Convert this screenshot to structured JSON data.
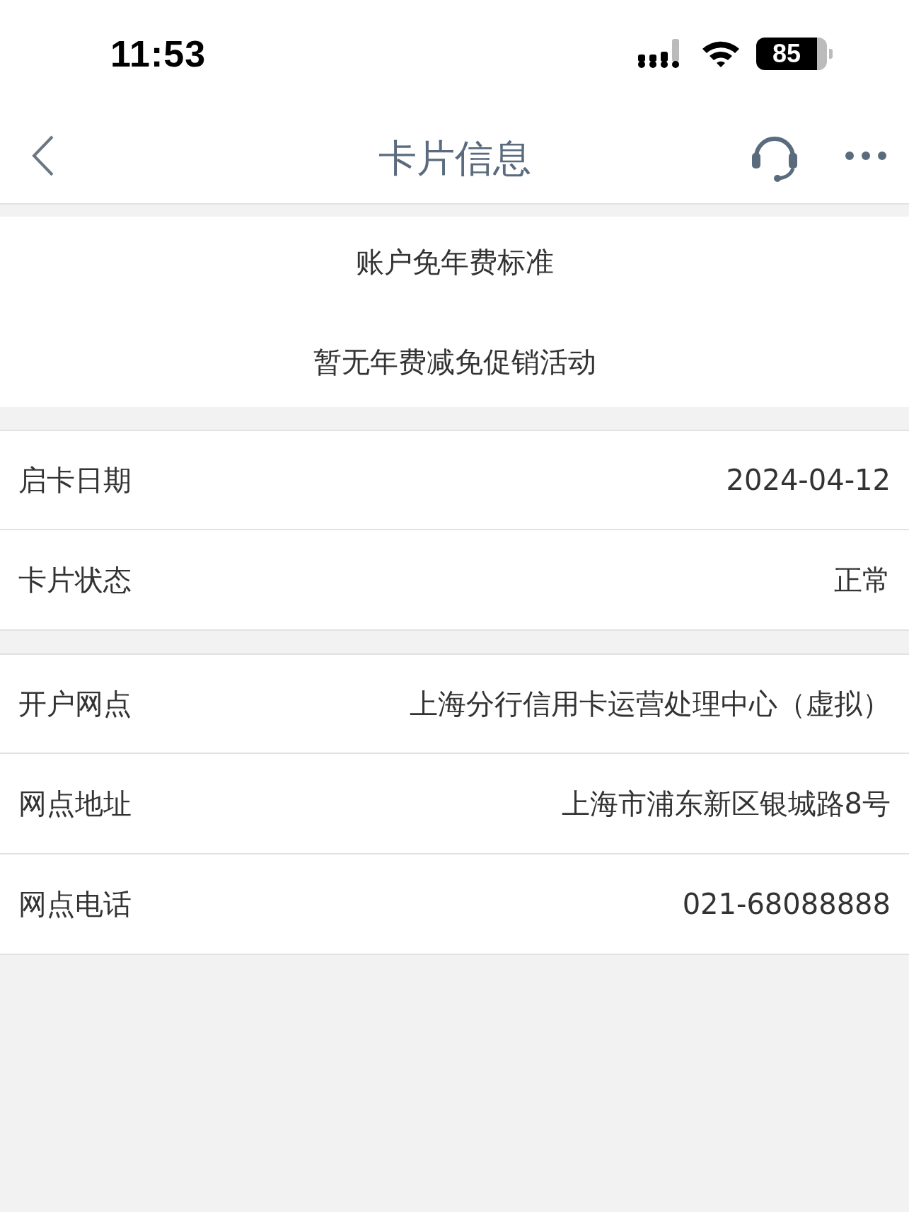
{
  "status_bar": {
    "time": "11:53",
    "battery": "85"
  },
  "header": {
    "title": "卡片信息"
  },
  "fee_section": {
    "title": "账户免年费标准",
    "message": "暂无年费减免促销活动"
  },
  "groups": [
    {
      "rows": [
        {
          "label": "启卡日期",
          "value": "2024-04-12"
        },
        {
          "label": "卡片状态",
          "value": "正常"
        }
      ]
    },
    {
      "rows": [
        {
          "label": "开户网点",
          "value": "上海分行信用卡运营处理中心（虚拟）"
        },
        {
          "label": "网点地址",
          "value": "上海市浦东新区银城路8号"
        },
        {
          "label": "网点电话",
          "value": "021-68088888"
        }
      ]
    }
  ]
}
